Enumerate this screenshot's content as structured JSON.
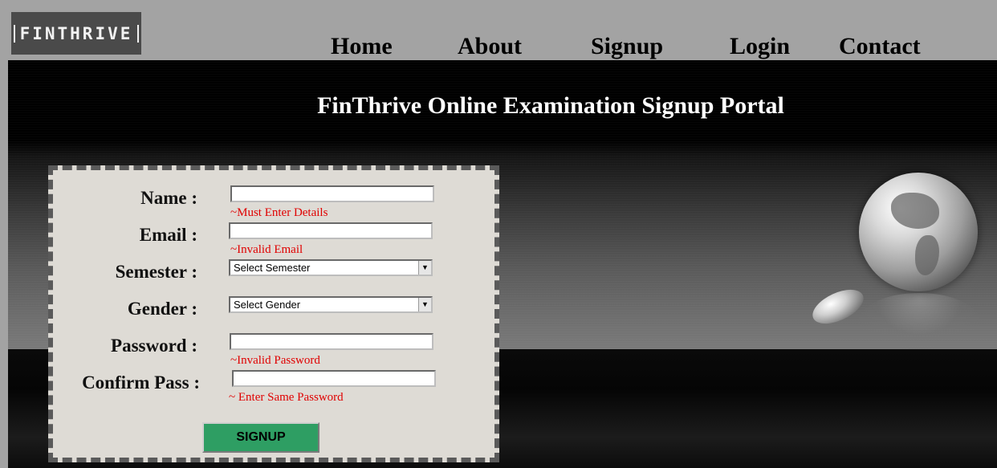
{
  "brand": {
    "logo_text": "FINTHRIVE"
  },
  "nav": {
    "items": [
      {
        "label": "Home"
      },
      {
        "label": "About"
      },
      {
        "label": "Signup"
      },
      {
        "label": "Login"
      },
      {
        "label": "Contact"
      }
    ]
  },
  "page": {
    "title": "FinThrive Online Examination Signup Portal"
  },
  "form": {
    "name": {
      "label": "Name :",
      "value": "",
      "error": "~Must Enter Details"
    },
    "email": {
      "label": "Email :",
      "value": "",
      "error": "~Invalid Email"
    },
    "semester": {
      "label": "Semester :",
      "selected": "Select Semester"
    },
    "gender": {
      "label": "Gender :",
      "selected": "Select Gender"
    },
    "password": {
      "label": "Password :",
      "value": "",
      "error": "~Invalid Password"
    },
    "confirm": {
      "label": "Confirm Pass :",
      "value": "",
      "error": "~ Enter Same Password"
    },
    "submit_label": "SIGNUP"
  }
}
